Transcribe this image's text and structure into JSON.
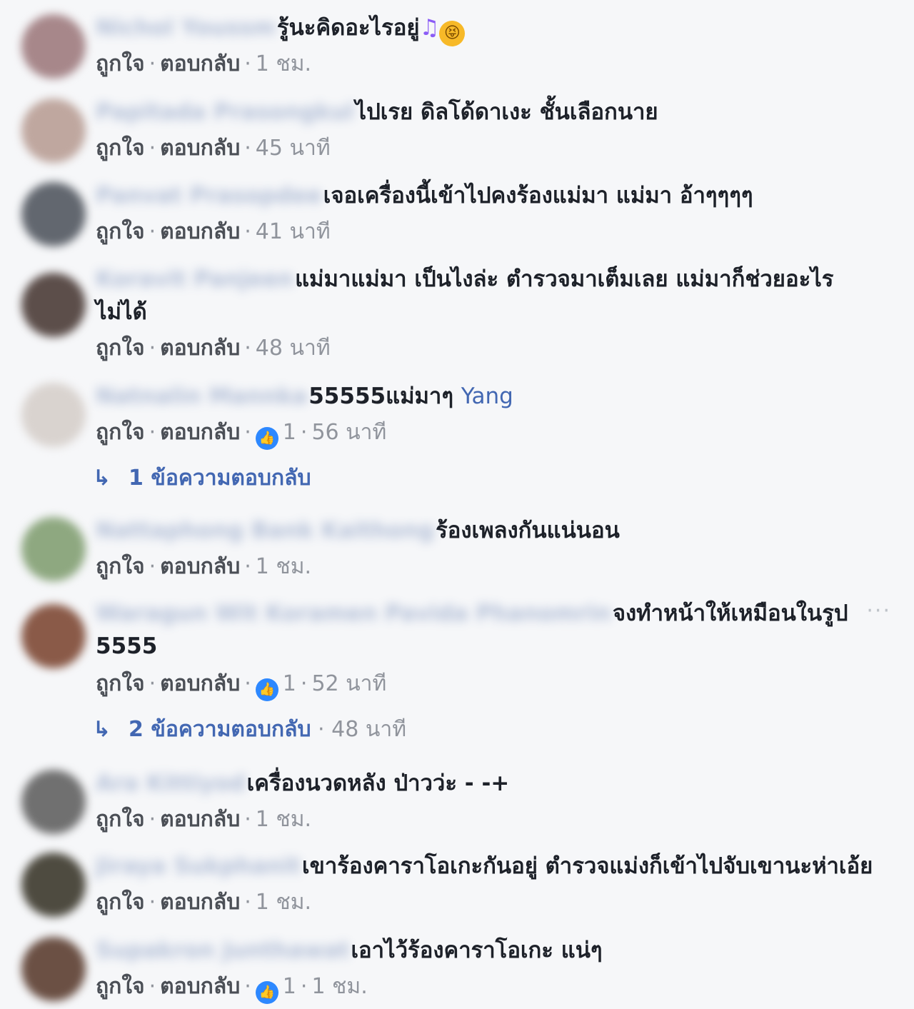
{
  "labels": {
    "like": "ถูกใจ",
    "reply": "ตอบกลับ",
    "sep": "·"
  },
  "comments": [
    {
      "name": "Nichol Youssm",
      "text": "รู้นะคิดอะไรอยู่",
      "emoji_note": "♫",
      "emoji_face": "😝",
      "time": "1 ชม."
    },
    {
      "name": "Papitada Prasongkul",
      "text": "ไปเรย ดิลโด้ดาเงะ ชั้นเลือกนาย",
      "time": "45 นาที"
    },
    {
      "name": "Panvat Prasopdee",
      "text": "เจอเครื่องนี้เข้าไปคงร้องแม่มา แม่มา อ้าๆๆๆๆ",
      "time": "41 นาที"
    },
    {
      "name": "Koravit Panjeen",
      "text": "แม่มาแม่มา เป็นไงล่ะ ตำรวจมาเต็มเลย แม่มาก็ช่วยอะไรไม่ได้",
      "time": "48 นาที"
    },
    {
      "name": "Natnalin Mannka",
      "text": "55555แม่มาๆ ",
      "tag": "Yang",
      "reactions": "1",
      "time": "56 นาที",
      "replies": "1 ข้อความตอบกลับ"
    },
    {
      "name": "Nattaphong Bank Kaithong",
      "text": "ร้องเพลงกันแน่นอน",
      "time": "1 ชม."
    },
    {
      "name": "Waragun Wit Koramen Pavida Phanomrin",
      "text": "จงทำหน้าให้เหมือนในรูป 5555",
      "reactions": "1",
      "time": "52 นาที",
      "replies": "2 ข้อความตอบกลับ",
      "replies_time": "48 นาที",
      "more": "···"
    },
    {
      "name": "Ara Kittiyod",
      "text": "เครื่องนวดหลัง ป่าวว่ะ - -+",
      "time": "1 ชม."
    },
    {
      "name": "Jiraya Sukphanit",
      "text": "เขาร้องคาราโอเกะกันอยู่ ตำรวจแม่งก็เข้าไปจับเขานะห่าเอ้ย",
      "time": "1 ชม."
    },
    {
      "name": "Supakron Junthawat",
      "text": "เอาไว้ร้องคาราโอเกะ แน่ๆ",
      "reactions": "1",
      "time": "1 ชม."
    }
  ]
}
